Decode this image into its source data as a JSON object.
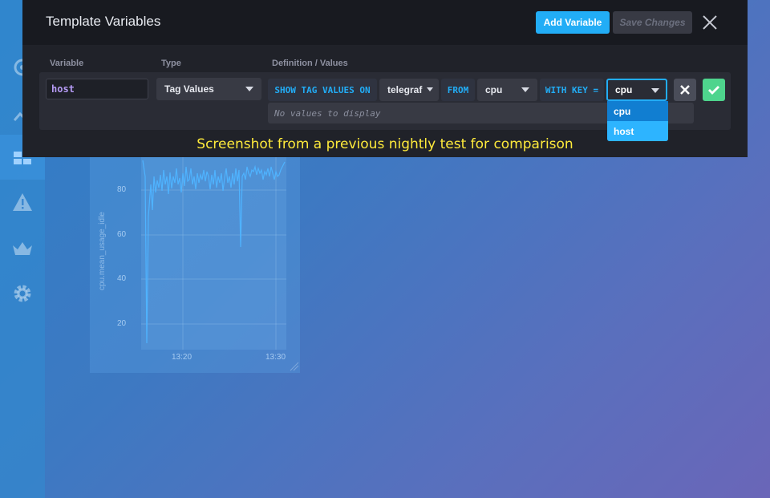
{
  "modal": {
    "title": "Template Variables",
    "add_variable_label": "Add Variable",
    "save_changes_label": "Save Changes",
    "columns": [
      "Variable",
      "Type",
      "Definition / Values"
    ]
  },
  "row": {
    "variable_value": "host",
    "type_value": "Tag Values",
    "keyword_show": "SHOW TAG VALUES ON",
    "database_value": "telegraf",
    "keyword_from": "FROM",
    "measurement_value": "cpu",
    "keyword_with_key": "WITH KEY =",
    "key_value": "cpu",
    "key_options": [
      "cpu",
      "host"
    ],
    "values_placeholder": "No values to display"
  },
  "background_graph": {
    "ylabel": "cpu.mean_usage_idle",
    "yticks": [
      "80",
      "60",
      "40",
      "20"
    ],
    "xticks": [
      "13:20",
      "13:30"
    ]
  },
  "caption": "Screenshot from a previous nightly test for comparison",
  "colors": {
    "accent": "#22adf6",
    "success": "#4ed48d",
    "caption": "#ffeb3b"
  }
}
